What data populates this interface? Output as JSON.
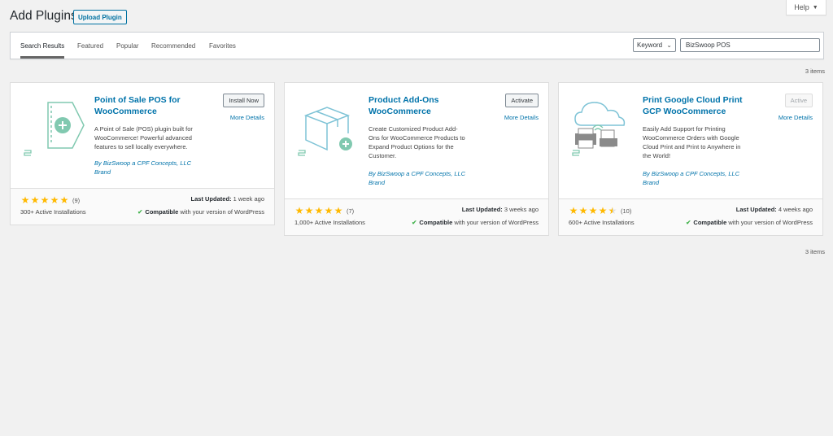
{
  "header": {
    "title": "Add Plugins",
    "upload_label": "Upload Plugin",
    "help_label": "Help"
  },
  "filter": {
    "tabs": [
      {
        "label": "Search Results",
        "current": true
      },
      {
        "label": "Featured"
      },
      {
        "label": "Popular"
      },
      {
        "label": "Recommended"
      },
      {
        "label": "Favorites"
      }
    ],
    "search_type": "Keyword",
    "search_value": "BizSwoop POS"
  },
  "results_count_top": "3 items",
  "results_count_bottom": "3 items",
  "colors": {
    "accent": "#0073aa",
    "star": "#ffb900",
    "icon": "#81c9b0",
    "check": "#46b450"
  },
  "plugins": [
    {
      "name_line1": "Point of Sale POS for",
      "name_line2": "WooCommerce",
      "action": "Install Now",
      "more": "More Details",
      "desc": [
        "A Point of Sale (POS) plugin built for",
        "WooCommerce! Powerful advanced",
        "features to sell locally everywhere."
      ],
      "author": [
        "By BizSwoop a CPF Concepts, LLC",
        "Brand"
      ],
      "rating": 5,
      "rating_count": "(9)",
      "installs": "300+ Active Installations",
      "updated_label": "Last Updated:",
      "updated_value": "1 week ago",
      "compat_label": "Compatible",
      "compat_text": "with your version of WordPress",
      "icon": "pos-tag-icon"
    },
    {
      "name_line1": "Product Add-Ons",
      "name_line2": "WooCommerce",
      "action": "Activate",
      "more": "More Details",
      "desc": [
        "Create Customized Product Add-",
        "Ons for WooCommerce Products to",
        "Expand Product Options for the",
        "Customer."
      ],
      "author": [
        "By BizSwoop a CPF Concepts, LLC",
        "Brand"
      ],
      "rating": 5,
      "rating_count": "(7)",
      "installs": "1,000+ Active Installations",
      "updated_label": "Last Updated:",
      "updated_value": "3 weeks ago",
      "compat_label": "Compatible",
      "compat_text": "with your version of WordPress",
      "icon": "box-add-icon"
    },
    {
      "name_line1": "Print Google Cloud Print",
      "name_line2": "GCP WooCommerce",
      "action": "Active",
      "more": "More Details",
      "desc": [
        "Easily Add Support for Printing",
        "WooCommerce Orders with Google",
        "Cloud Print and Print to Anywhere in",
        "the World!"
      ],
      "author": [
        "By BizSwoop a CPF Concepts, LLC",
        "Brand"
      ],
      "rating": 4.5,
      "rating_count": "(10)",
      "installs": "600+ Active Installations",
      "updated_label": "Last Updated:",
      "updated_value": "4 weeks ago",
      "compat_label": "Compatible",
      "compat_text": "with your version of WordPress",
      "icon": "cloud-print-icon"
    }
  ]
}
